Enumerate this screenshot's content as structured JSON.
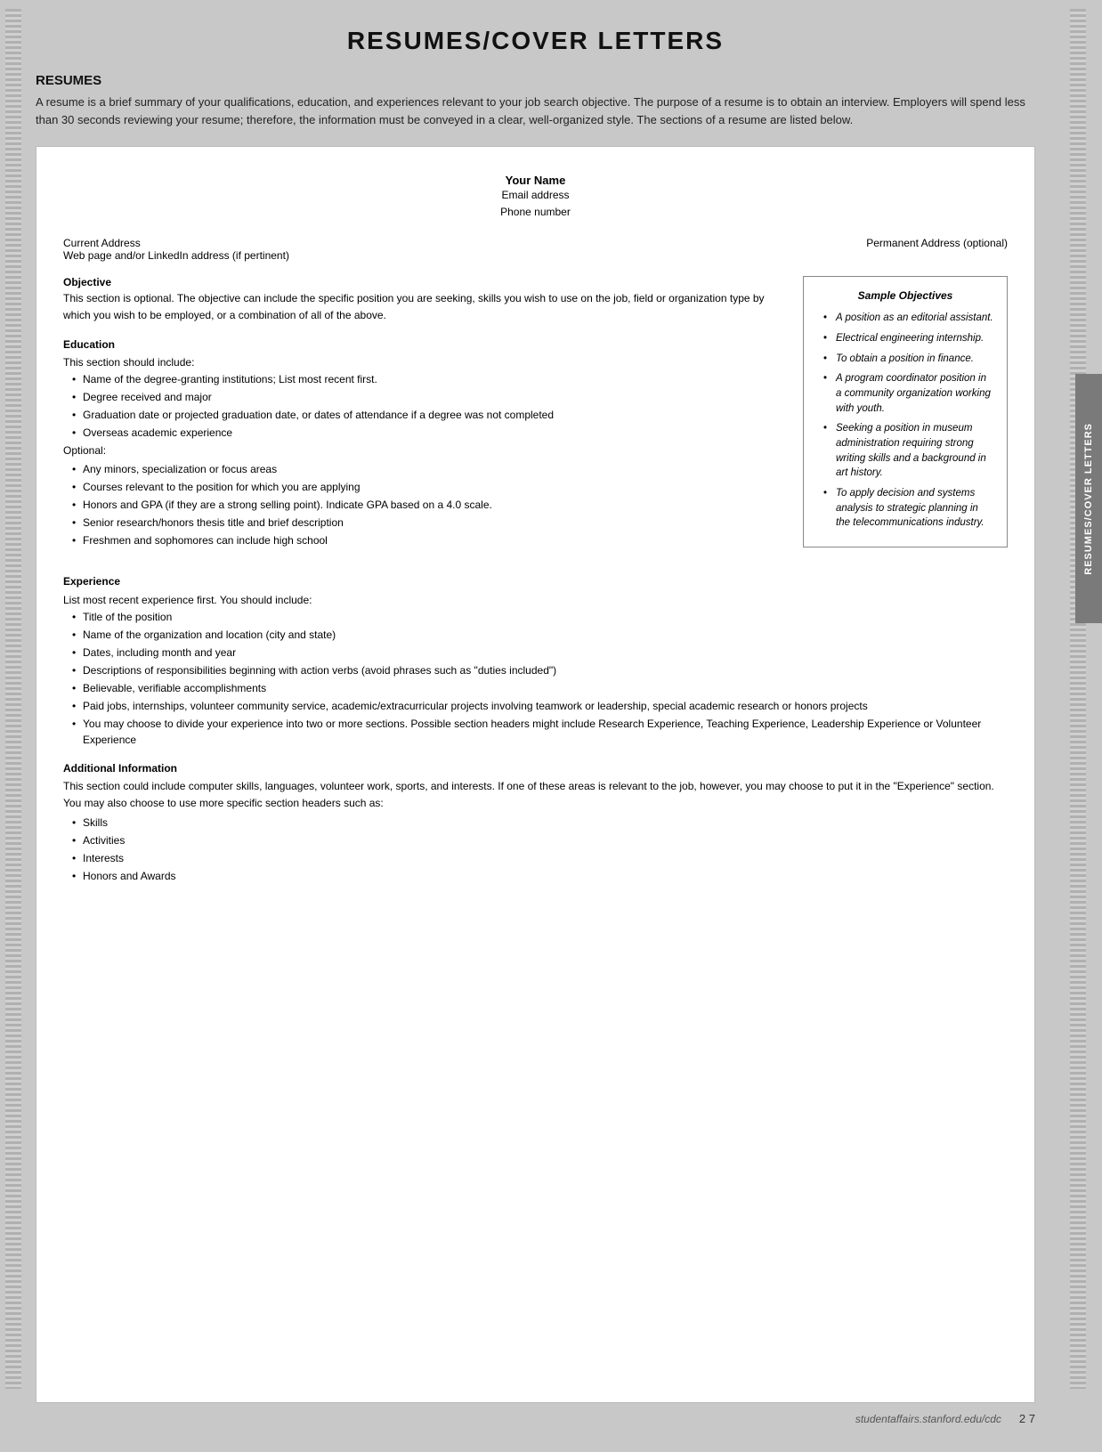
{
  "page": {
    "title": "RESUMES/COVER LETTERS",
    "vertical_tab_label": "RESUMES/COVER LETTERS"
  },
  "resumes_section": {
    "heading": "RESUMES",
    "intro": "A resume is a brief summary of your qualifications, education, and experiences relevant to your job search objective. The purpose of a resume is to obtain an interview. Employers will spend less than 30 seconds reviewing your resume; therefore, the information must be conveyed in a clear, well-organized style. The sections of a resume are listed below."
  },
  "resume_document": {
    "header": {
      "name": "Your Name",
      "email": "Email address",
      "phone": "Phone number"
    },
    "address": {
      "current": "Current Address",
      "current_sub": "Web page and/or LinkedIn address (if pertinent)",
      "permanent": "Permanent Address (optional)"
    },
    "objective": {
      "title": "Objective",
      "text": "This section is optional. The objective can include the specific position you are seeking, skills you wish to use on the job, field or organization type by which you wish to be employed, or a combination of all of the above."
    },
    "sample_objectives": {
      "title": "Sample Objectives",
      "items": [
        "A position as an editorial assistant.",
        "Electrical engineering internship.",
        "To obtain a position in finance.",
        "A program coordinator position in a community organization working with youth.",
        "Seeking a position in museum administration requiring strong writing skills and a background in art history.",
        "To apply decision and systems analysis to strategic planning in the telecommunications industry."
      ]
    },
    "education": {
      "title": "Education",
      "intro": "This section should include:",
      "required_items": [
        "Name of the degree-granting institutions; List most recent first.",
        "Degree received and major",
        "Graduation date or projected graduation date, or dates of attendance if a degree was not completed",
        "Overseas academic experience"
      ],
      "optional_label": "Optional:",
      "optional_items": [
        "Any minors, specialization or focus areas",
        "Courses relevant to the position for which you are applying",
        "Honors and GPA (if they are a strong selling point). Indicate GPA based on a 4.0 scale.",
        "Senior research/honors thesis title and brief description",
        "Freshmen and sophomores can include high school"
      ]
    },
    "experience": {
      "title": "Experience",
      "intro": "List most recent experience first. You should include:",
      "items": [
        "Title of the position",
        "Name of the organization and location (city and state)",
        "Dates, including month and year",
        "Descriptions of responsibilities beginning with action verbs (avoid phrases such as \"duties included\")",
        "Believable, verifiable accomplishments",
        "Paid jobs, internships, volunteer community service, academic/extracurricular projects involving teamwork or leadership, special academic research or honors projects",
        "You may choose to divide your experience into two or more sections. Possible section headers might include Research Experience, Teaching Experience, Leadership Experience or Volunteer Experience"
      ]
    },
    "additional_information": {
      "title": "Additional Information",
      "text": "This section could include computer skills, languages, volunteer work, sports, and interests. If one of these areas is relevant to the job, however, you may choose to put it in the \"Experience\" section. You may also choose to use more specific section headers such as:",
      "items": [
        "Skills",
        "Activities",
        "Interests",
        "Honors and Awards"
      ]
    }
  },
  "footer": {
    "url": "studentaffairs.stanford.edu/cdc",
    "page": "2  7"
  }
}
